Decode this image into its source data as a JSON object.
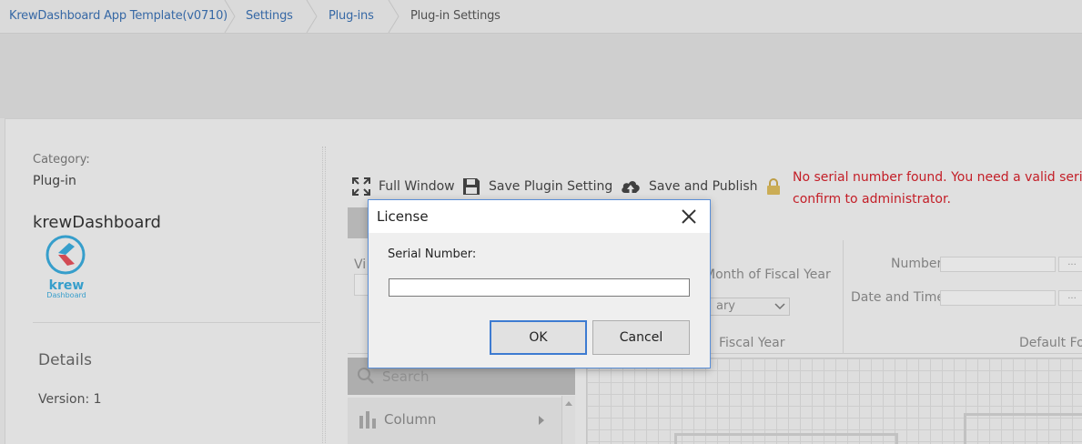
{
  "breadcrumb": {
    "items": [
      "KrewDashboard App Template(v0710)",
      "Settings",
      "Plug-ins",
      "Plug-in Settings"
    ]
  },
  "sidebar": {
    "category_label": "Category:",
    "category_value": "Plug-in",
    "app_name": "krewDashboard",
    "logo_text": "krew",
    "logo_subtext": "Dashboard",
    "details_heading": "Details",
    "version": "Version: 1"
  },
  "toolbar": {
    "full_window": "Full Window",
    "save_plugin_setting": "Save Plugin Setting",
    "save_and_publish": "Save and Publish"
  },
  "error": {
    "line1": "No serial number found. You need a valid serial",
    "line2": "confirm to administrator."
  },
  "settings": {
    "vi_fragment": "Vi",
    "month_label": "Month of Fiscal Year",
    "month_select": "ary",
    "fiscal_year_label": "Fiscal Year",
    "number_label": "Number",
    "date_time_label": "Date and Time",
    "default_fo_label": "Default Fo",
    "ellipsis": "..."
  },
  "palette": {
    "search_placeholder": "Search",
    "column_label": "Column"
  },
  "dialog": {
    "title": "License",
    "serial_label": "Serial Number:",
    "serial_value": "",
    "ok_label": "OK",
    "cancel_label": "Cancel"
  },
  "colors": {
    "link": "#3a6fb0",
    "error": "#d0202a",
    "accent": "#3d7bd1",
    "logo_red": "#e0505a",
    "logo_blue": "#3aa8d8"
  }
}
